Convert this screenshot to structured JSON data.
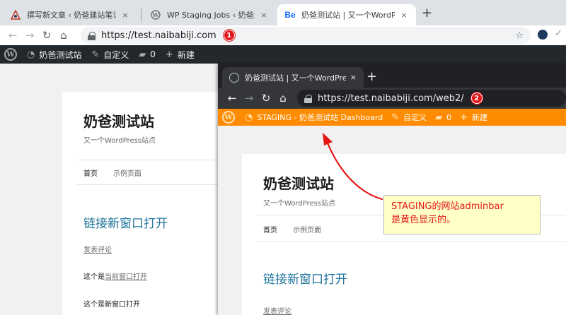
{
  "back_browser": {
    "tabs": [
      {
        "title": "撰写新文章 ‹ 奶爸建站笔记 — W",
        "icon": "wp-admin-favicon",
        "close": "×"
      },
      {
        "title": "WP Staging Jobs ‹ 奶爸测试站 —",
        "icon": "wordpress-icon",
        "close": "×"
      },
      {
        "title": "又一个WordPress站",
        "prefix": "奶爸测试站 |",
        "icon": "behance-favicon",
        "favicon_text": "Be",
        "close": "×"
      }
    ],
    "new_tab": "+",
    "url": "https://test.naibabiji.com",
    "url_badge": "1",
    "admin_bar": {
      "color": "#23282d",
      "site_name": "奶爸测试站",
      "customize": "自定义",
      "comments": "0",
      "new": "新建"
    },
    "page": {
      "site_title": "奶爸测试站",
      "site_description": "又一个WordPress站点",
      "menu": [
        "首页",
        "示例页面"
      ],
      "post_title": "链接新窗口打开",
      "comment_link": "发表评论",
      "para1_prefix": "这个是",
      "para1_link": "当前窗口打开",
      "para2": "这个是新窗口打开"
    }
  },
  "front_browser": {
    "tab_title": "奶爸测试站 | 又一个WordPress站",
    "close": "×",
    "new_tab": "+",
    "url": "https://test.naibabiji.com/web2/",
    "url_badge": "2",
    "admin_bar": {
      "color": "#ff8c00",
      "site_name": "STAGING - 奶爸测试站 Dashboard",
      "customize": "自定义",
      "comments": "0",
      "new": "新建"
    },
    "page": {
      "site_title": "奶爸测试站",
      "site_description": "又一个WordPress站点",
      "menu": [
        "首页",
        "示例页面"
      ],
      "post_title": "链接新窗口打开",
      "comment_link": "发表评论"
    }
  },
  "annotation": {
    "line1": "STAGING的网站adminbar",
    "line2": "是黄色显示的。",
    "color": "#e31515"
  }
}
